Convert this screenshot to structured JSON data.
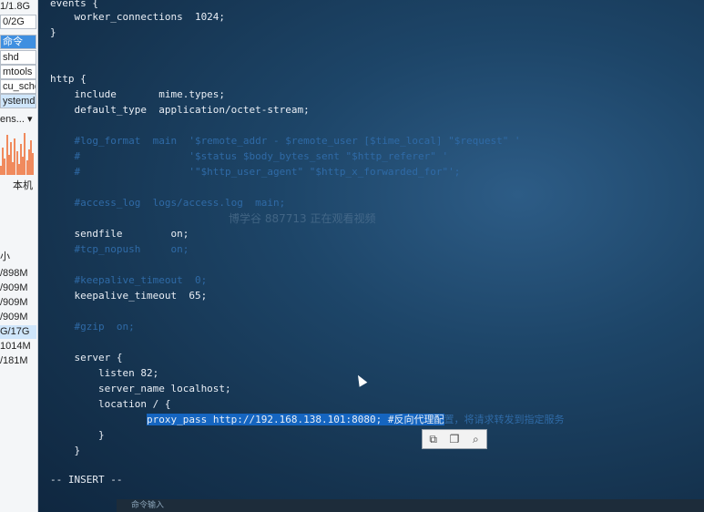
{
  "sidepanel": {
    "mem_top": "1/1.8G",
    "swap": "0/2G",
    "proc_tab": "命令",
    "processes": [
      "shd",
      "mtools",
      "cu_sche",
      "ystemd"
    ],
    "net_label": "ens...",
    "machine_label": "本机",
    "disk_header": "小",
    "disks": [
      "/898M",
      "/909M",
      "/909M",
      "/909M",
      "G/17G",
      "1014M",
      "/181M"
    ]
  },
  "terminal": {
    "lines": [
      {
        "text": "events {",
        "style": "normal"
      },
      {
        "text": "    worker_connections  1024;",
        "style": "normal"
      },
      {
        "text": "}",
        "style": "normal"
      },
      {
        "text": "",
        "style": "normal"
      },
      {
        "text": "",
        "style": "normal"
      },
      {
        "text": "http {",
        "style": "normal"
      },
      {
        "text": "    include       mime.types;",
        "style": "normal"
      },
      {
        "text": "    default_type  application/octet-stream;",
        "style": "normal"
      },
      {
        "text": "",
        "style": "normal"
      },
      {
        "text": "    #log_format  main  '$remote_addr - $remote_user [$time_local] \"$request\" '",
        "style": "dim"
      },
      {
        "text": "    #                  '$status $body_bytes_sent \"$http_referer\" '",
        "style": "dim"
      },
      {
        "text": "    #                  '\"$http_user_agent\" \"$http_x_forwarded_for\"';",
        "style": "dim"
      },
      {
        "text": "",
        "style": "normal"
      },
      {
        "text": "    #access_log  logs/access.log  main;",
        "style": "dim"
      },
      {
        "text": "",
        "style": "normal"
      },
      {
        "text": "    sendfile        on;",
        "style": "normal"
      },
      {
        "text": "    #tcp_nopush     on;",
        "style": "dim"
      },
      {
        "text": "",
        "style": "normal"
      },
      {
        "text": "    #keepalive_timeout  0;",
        "style": "dim"
      },
      {
        "text": "    keepalive_timeout  65;",
        "style": "normal"
      },
      {
        "text": "",
        "style": "normal"
      },
      {
        "text": "    #gzip  on;",
        "style": "dim"
      },
      {
        "text": "",
        "style": "normal"
      },
      {
        "text": "    server {",
        "style": "normal"
      },
      {
        "text": "        listen 82;",
        "style": "normal"
      },
      {
        "text": "        server_name localhost;",
        "style": "normal"
      },
      {
        "text": "        location / {",
        "style": "normal"
      },
      {
        "text": "                proxy_pass http://192.168.138.101:8080; #反向代理配置，将请求转发到指定服务",
        "style": "selected"
      },
      {
        "text": "        }",
        "style": "normal"
      },
      {
        "text": "    }",
        "style": "normal"
      },
      {
        "text": "",
        "style": "normal"
      },
      {
        "text": "-- INSERT --",
        "style": "normal"
      }
    ],
    "watermark": "博学谷 887713 正在观看视频"
  },
  "selection_toolbar": {
    "copy_icon": "copy-icon",
    "paste_icon": "paste-icon",
    "search_icon": "search-icon"
  },
  "bottom_panel": {
    "text": "命令输入"
  }
}
